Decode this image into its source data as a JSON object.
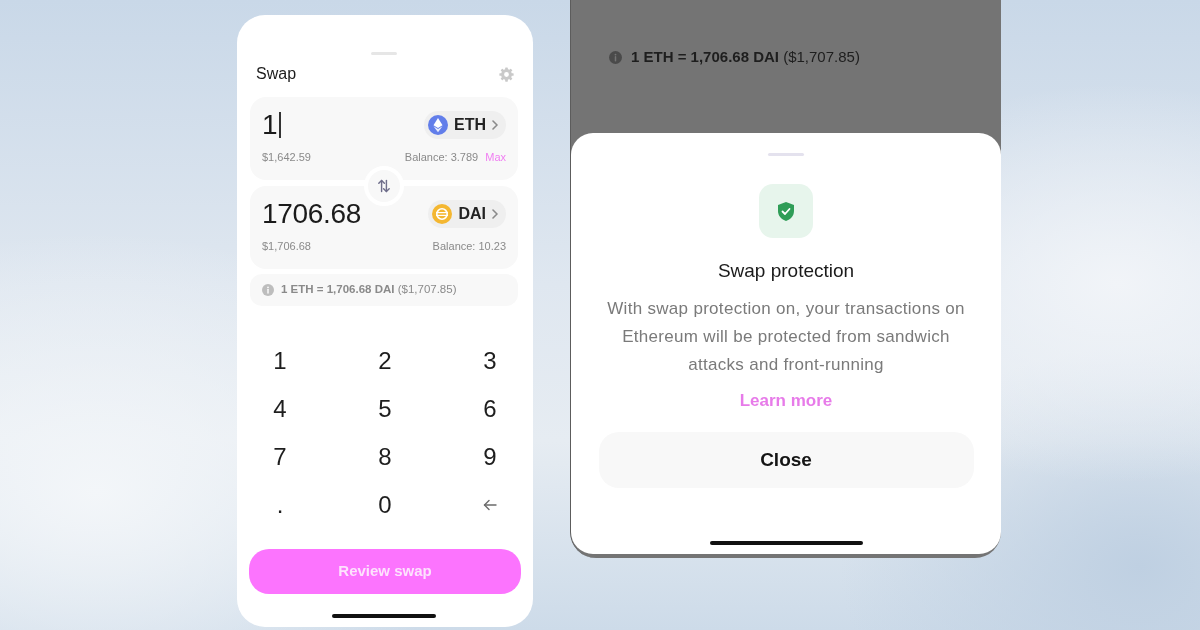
{
  "swap_screen": {
    "title": "Swap",
    "token_fields": [
      {
        "amount": "1",
        "focused": true,
        "token": "ETH",
        "color": "#627eea",
        "fiat_value": "$1,642.59",
        "balance": "Balance: 3.789",
        "max_label": "Max"
      },
      {
        "amount": "1706.68",
        "focused": false,
        "token": "DAI",
        "color": "#f4b731",
        "fiat_value": "$1,706.68",
        "balance": "Balance: 10.23"
      }
    ],
    "exchange_rate": "**1 ETH = 1,706.68 DAI** ($1,707.85)",
    "keypad": [
      {
        "kind": "digit",
        "label": "1"
      },
      {
        "kind": "digit",
        "label": "2"
      },
      {
        "kind": "digit",
        "label": "3"
      },
      {
        "kind": "digit",
        "label": "4"
      },
      {
        "kind": "digit",
        "label": "5"
      },
      {
        "kind": "digit",
        "label": "6"
      },
      {
        "kind": "digit",
        "label": "7"
      },
      {
        "kind": "digit",
        "label": "8"
      },
      {
        "kind": "digit",
        "label": "9"
      },
      {
        "kind": "digit",
        "label": "."
      },
      {
        "kind": "digit",
        "label": "0"
      },
      {
        "kind": "backspace"
      }
    ],
    "review_button": "Review swap"
  },
  "background_screen": {
    "exchange_rate": "**1 ETH = 1,706.68 DAI** ($1,707.85)"
  },
  "protection_sheet": {
    "title": "Swap protection",
    "description": "With swap protection on, your transactions on Ethereum will be protected from sandwich attacks and front-running",
    "link": "Learn more",
    "button": "Close"
  }
}
